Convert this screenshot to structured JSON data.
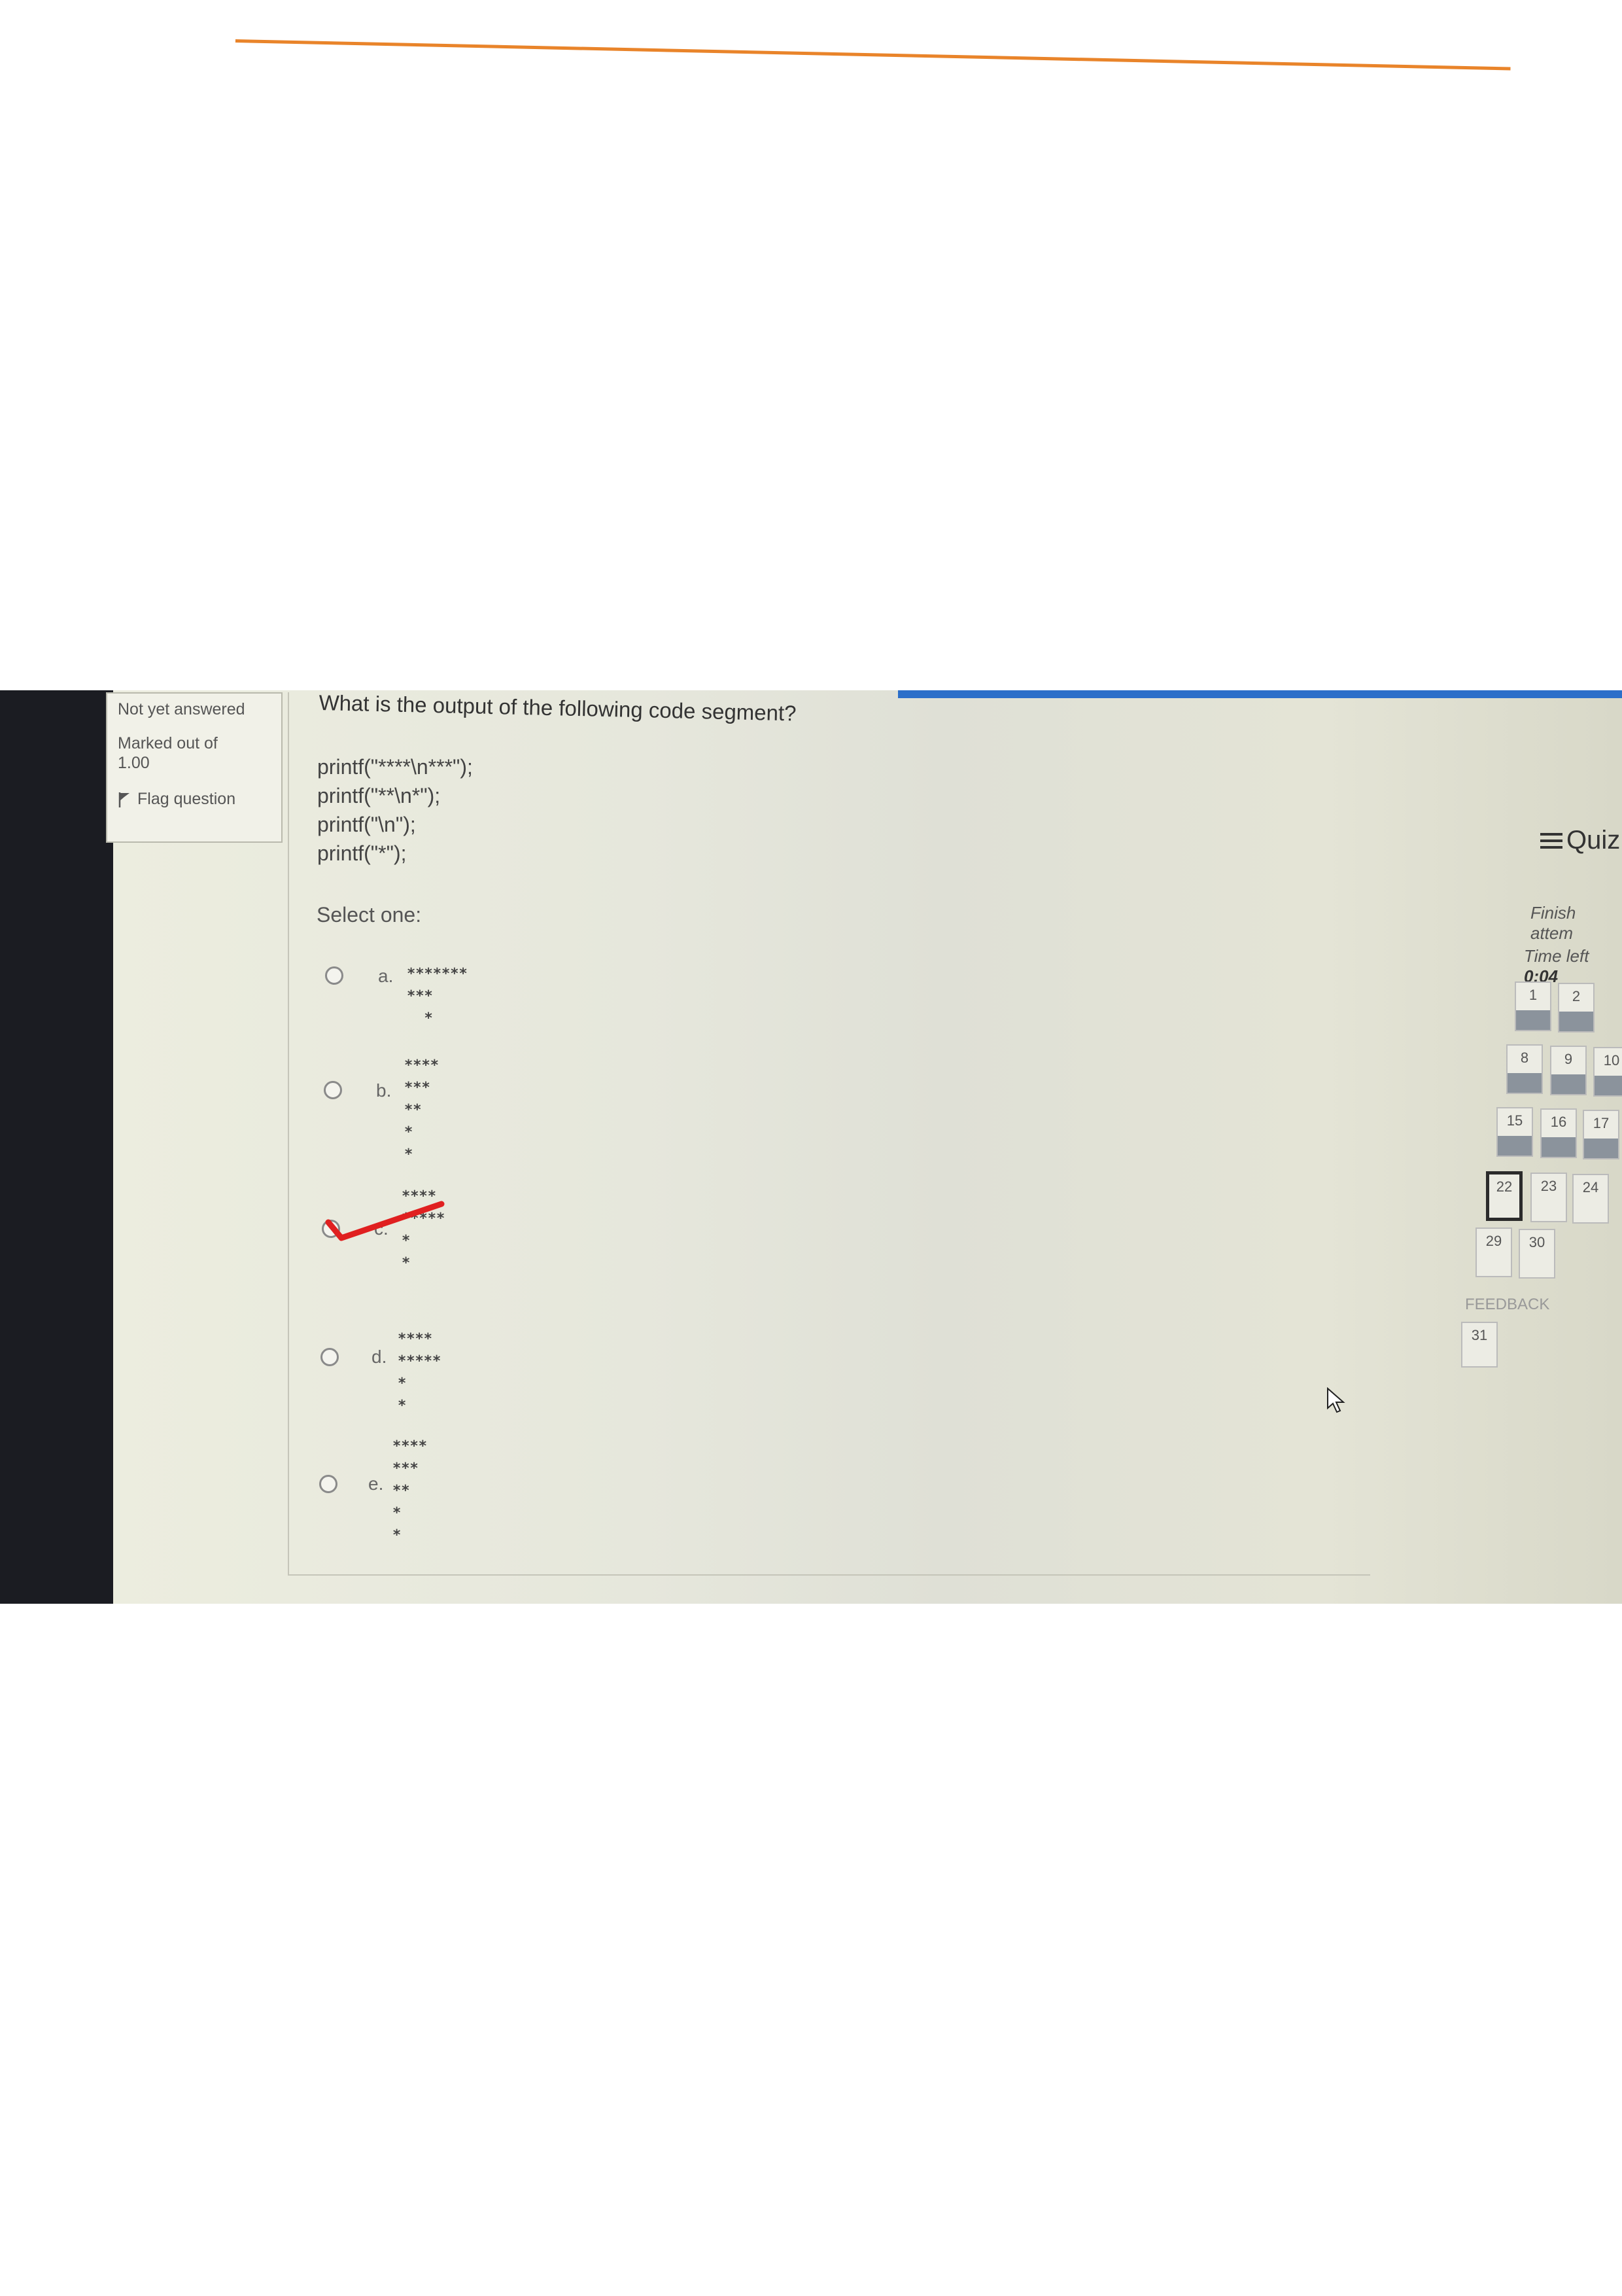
{
  "question_info": {
    "status": "Not yet answered",
    "marked_label": "Marked out of",
    "marked_value": "1.00",
    "flag_label": "Flag question"
  },
  "question": {
    "text": "What is the output of the following code segment?",
    "code_lines": [
      "printf(\"****\\n***\");",
      "printf(\"**\\n*\");",
      "printf(\"\\n\");",
      "printf(\"*\");"
    ],
    "select_label": "Select one:",
    "options": [
      {
        "letter": "a.",
        "lines": [
          "*******",
          "***",
          "  *"
        ]
      },
      {
        "letter": "b.",
        "lines": [
          "****",
          "***",
          "**",
          "*",
          "*"
        ]
      },
      {
        "letter": "c.",
        "lines": [
          "****",
          "*****",
          "*",
          "",
          "*"
        ]
      },
      {
        "letter": "d.",
        "lines": [
          "****",
          "*****",
          "*",
          "*"
        ]
      },
      {
        "letter": "e.",
        "lines": [
          "****",
          "***",
          "**",
          "*",
          "",
          "*"
        ]
      }
    ],
    "marked_option": "c."
  },
  "quiz_nav": {
    "title": "Quiz",
    "finish_label": "Finish attem",
    "time_label": "Time left",
    "time_value": "0:04",
    "question_numbers": [
      "1",
      "2",
      "8",
      "9",
      "10",
      "15",
      "16",
      "17",
      "22",
      "23",
      "24",
      "29",
      "30"
    ],
    "current_question": "22",
    "feedback_label": "FEEDBACK",
    "feedback_numbers": [
      "31"
    ]
  },
  "colors": {
    "accent_orange": "#e9842a",
    "top_blue": "#2c6fc9",
    "check_red": "#e02020",
    "answered_bar": "#8b939c"
  }
}
